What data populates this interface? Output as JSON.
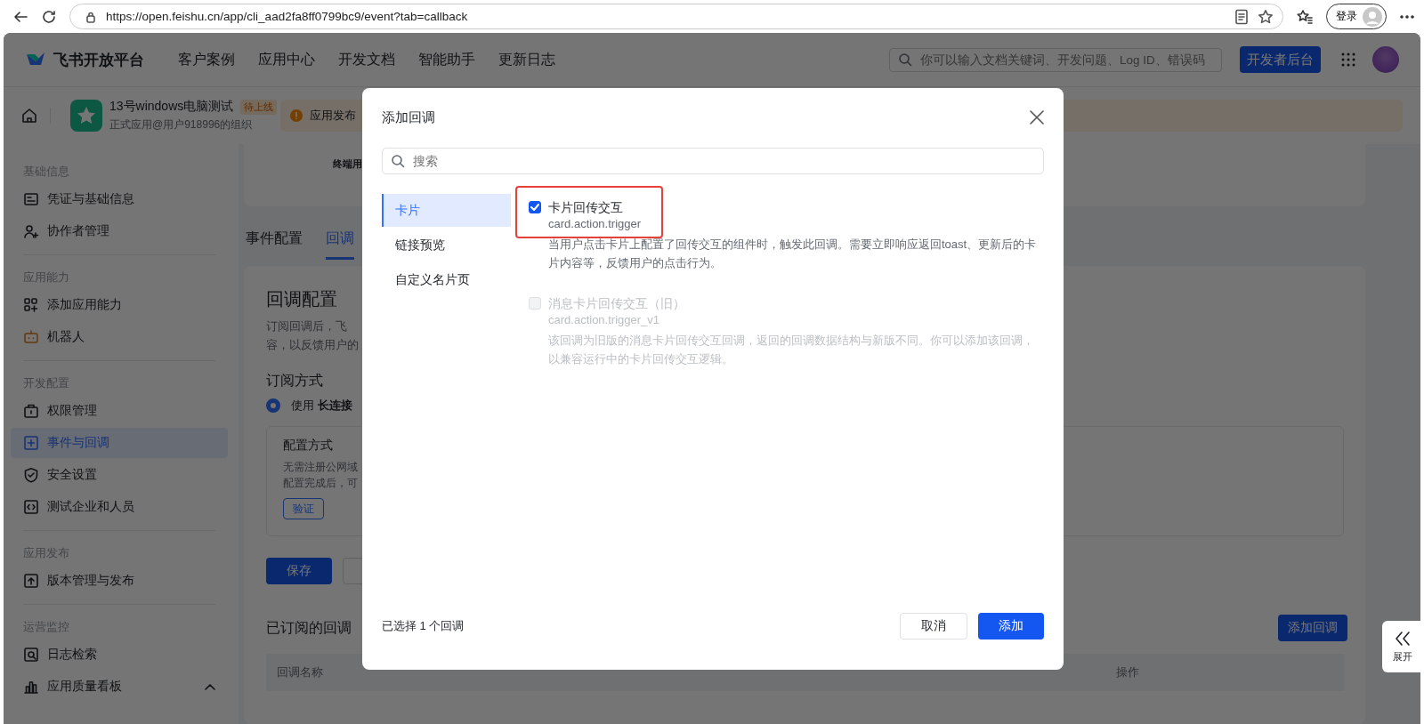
{
  "browser": {
    "url": "https://open.feishu.cn/app/cli_aad2fa8ff0799bc9/event?tab=callback",
    "login": "登录"
  },
  "topnav": {
    "brand": "飞书开放平台",
    "links": [
      "客户案例",
      "应用中心",
      "开发文档",
      "智能助手",
      "更新日志"
    ],
    "search": {
      "placeholder": "你可以输入文档关键词、开发问题、Log ID、错误码"
    },
    "console_button": "开发者后台"
  },
  "app_header": {
    "name": "13号windows电脑测试",
    "tag": "待上线",
    "subtitle": "正式应用@用户918996的组织",
    "banner": "应用发布"
  },
  "sidebar": [
    {
      "title": "基础信息",
      "items": [
        {
          "label": "凭证与基础信息",
          "kind": "link",
          "selected": false
        },
        {
          "label": "协作者管理",
          "kind": "link",
          "selected": false
        }
      ]
    },
    {
      "title": "应用能力",
      "items": [
        {
          "label": "添加应用能力",
          "kind": "link",
          "selected": false
        },
        {
          "label": "机器人",
          "kind": "link",
          "selected": false
        }
      ]
    },
    {
      "title": "开发配置",
      "items": [
        {
          "label": "权限管理",
          "kind": "link",
          "selected": false
        },
        {
          "label": "事件与回调",
          "kind": "link",
          "selected": true
        },
        {
          "label": "安全设置",
          "kind": "link",
          "selected": false
        },
        {
          "label": "测试企业和人员",
          "kind": "link",
          "selected": false
        }
      ]
    },
    {
      "title": "应用发布",
      "items": [
        {
          "label": "版本管理与发布",
          "kind": "link",
          "selected": false
        }
      ]
    },
    {
      "title": "运营监控",
      "items": [
        {
          "label": "日志检索",
          "kind": "link",
          "selected": false
        },
        {
          "label": "应用质量看板",
          "kind": "group",
          "expanded": true,
          "selected": false
        }
      ]
    }
  ],
  "main": {
    "top_card_text": "终端用",
    "tabs": [
      {
        "label": "事件配置",
        "selected": false
      },
      {
        "label": "回调",
        "selected": true
      }
    ],
    "section_title": "回调配置",
    "description": [
      "订阅回调后，飞",
      "容，以反馈用户的"
    ],
    "subscribe_title": "订阅方式",
    "radio": {
      "label": "使用 **长连接**",
      "selected": true
    },
    "config_box": {
      "title": "配置方式",
      "lines": [
        "无需注册公网域",
        "配置完成后，可"
      ],
      "verify_button": "验证"
    },
    "save_button": "保存",
    "subscribed_title": "已订阅的回调",
    "add_button": "添加回调",
    "table_columns": [
      "回调名称",
      "操作"
    ]
  },
  "dialog": {
    "title": "添加回调",
    "search": {
      "placeholder": "搜索"
    },
    "categories": [
      {
        "label": "卡片",
        "selected": true
      },
      {
        "label": "链接预览",
        "selected": false
      },
      {
        "label": "自定义名片页",
        "selected": false
      }
    ],
    "callbacks": [
      {
        "name": "卡片回传交互",
        "event": "card.action.trigger",
        "description": "当用户点击卡片上配置了回传交互的组件时，触发此回调。需要立即响应返回toast、更新后的卡片内容等，反馈用户的点击行为。",
        "checked": true,
        "disabled": false,
        "highlighted": true
      },
      {
        "name": "消息卡片回传交互（旧）",
        "event": "card.action.trigger_v1",
        "description": "该回调为旧版的消息卡片回传交互回调，返回的回调数据结构与新版不同。你可以添加该回调，以兼容运行中的卡片回传交互逻辑。",
        "checked": false,
        "disabled": true,
        "highlighted": false
      }
    ],
    "footer_text": "已选择 1 个回调",
    "cancel_button": "取消",
    "confirm_button": "添加"
  },
  "expand_tab": {
    "label": "展开"
  }
}
